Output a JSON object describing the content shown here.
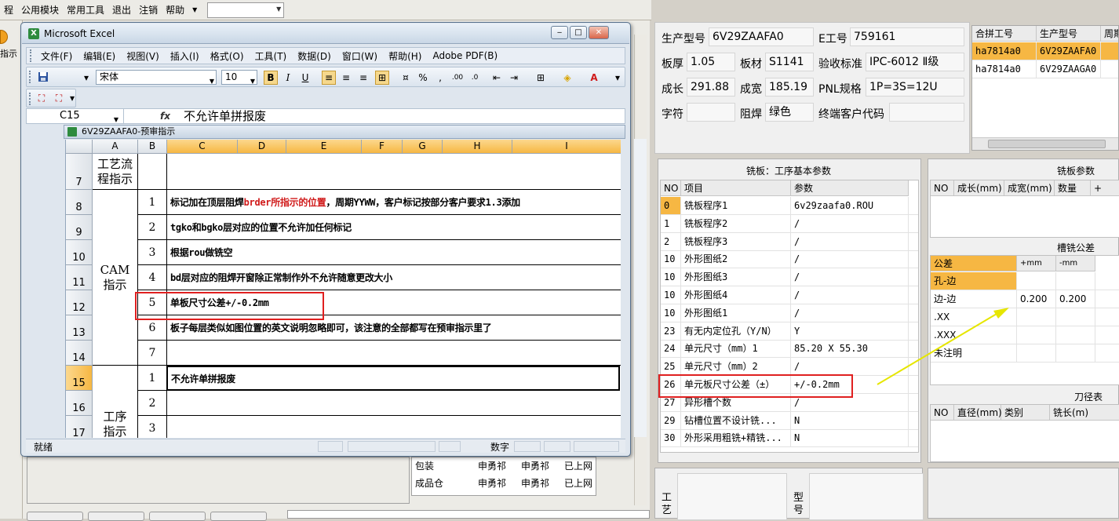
{
  "app_menu": [
    "程",
    "公用模块",
    "常用工具",
    "退出",
    "注销",
    "帮助"
  ],
  "left_label": "指示",
  "excel": {
    "title": "Microsoft Excel",
    "menu": [
      "文件(F)",
      "编辑(E)",
      "视图(V)",
      "插入(I)",
      "格式(O)",
      "工具(T)",
      "数据(D)",
      "窗口(W)",
      "帮助(H)",
      "Adobe PDF(B)"
    ],
    "font_name": "宋体",
    "font_size": "10",
    "name_box": "C15",
    "fx": "fx",
    "formula_value": "不允许单拼报废",
    "workbook_title": "6V29ZAAFA0-预审指示",
    "columns": [
      "A",
      "B",
      "C",
      "D",
      "E",
      "F",
      "G",
      "H",
      "I"
    ],
    "rows": [
      {
        "num": "7",
        "b": "",
        "c": ""
      },
      {
        "num": "8",
        "b": "1",
        "c_pre": "标记加在顶层阻焊",
        "c_red": "brder所指示的位置",
        "c_post": "，周期YYWW，客户标记按部分客户要求1.3添加"
      },
      {
        "num": "9",
        "b": "2",
        "c": "tgko和bgko层对应的位置不允许加任何标记"
      },
      {
        "num": "10",
        "b": "3",
        "c": "根据rou做铣空"
      },
      {
        "num": "11",
        "b": "4",
        "c": "bd层对应的阻焊开窗除正常制作外不允许随意更改大小"
      },
      {
        "num": "12",
        "b": "5",
        "c": "单板尺寸公差+/-0.2mm"
      },
      {
        "num": "13",
        "b": "6",
        "c": "板子每层类似如图位置的英文说明忽略即可，该注意的全部都写在预审指示里了"
      },
      {
        "num": "14",
        "b": "7",
        "c": ""
      },
      {
        "num": "15",
        "b": "1",
        "c": "不允许单拼报废"
      },
      {
        "num": "16",
        "b": "2",
        "c": ""
      },
      {
        "num": "17",
        "b": "3",
        "c": ""
      }
    ],
    "group_labels": {
      "g1": "工艺流程指示",
      "g2": "CAM指示",
      "g3": "工序指示"
    },
    "status_ready": "就绪",
    "status_num": "数字"
  },
  "behind_table": [
    [
      "包装",
      "申勇祁",
      "申勇祁",
      "已上网"
    ],
    [
      "成品仓",
      "申勇祁",
      "申勇祁",
      "已上网"
    ]
  ],
  "product_info": {
    "model_label": "生产型号",
    "model_value": "6V29ZAAFA0",
    "eid_label": "E工号",
    "eid_value": "759161",
    "thick_label": "板厚",
    "thick_value": "1.05",
    "material_label": "板材",
    "material_value": "S1141",
    "accept_label": "验收标准",
    "accept_value": "IPC-6012 Ⅱ级",
    "len_label": "成长",
    "len_value": "291.88",
    "width_label": "成宽",
    "width_value": "185.19",
    "pnl_label": "PNL规格",
    "pnl_value": "1P=3S=12U",
    "char_label": "字符",
    "char_value": "",
    "mask_label": "阻焊",
    "mask_value": "绿色",
    "endcust_label": "终端客户代码",
    "endcust_value": ""
  },
  "merge_table": {
    "headers": [
      "合拼工号",
      "生产型号",
      "周期"
    ],
    "rows": [
      [
        "ha7814a0",
        "6V29ZAAFA0",
        ""
      ],
      [
        "ha7814a0",
        "6V29ZAAGA0",
        ""
      ]
    ]
  },
  "mill_params": {
    "title": "铣板：工序基本参数",
    "headers": [
      "NO",
      "项目",
      "参数"
    ],
    "rows": [
      [
        "0",
        "铣板程序1",
        "6v29zaafa0.ROU"
      ],
      [
        "1",
        "铣板程序2",
        "/"
      ],
      [
        "2",
        "铣板程序3",
        "/"
      ],
      [
        "10",
        "外形图纸2",
        "/"
      ],
      [
        "10",
        "外形图纸3",
        "/"
      ],
      [
        "10",
        "外形图纸4",
        "/"
      ],
      [
        "10",
        "外形图纸1",
        "/"
      ],
      [
        "23",
        "有无内定位孔（Y/N）",
        "Y"
      ],
      [
        "24",
        "单元尺寸（mm）1",
        "85.20 X 55.30"
      ],
      [
        "25",
        "单元尺寸（mm）2",
        "/"
      ],
      [
        "26",
        "单元板尺寸公差（±）",
        "+/-0.2mm"
      ],
      [
        "27",
        "异形槽个数",
        "/"
      ],
      [
        "29",
        "钻槽位置不设计铣...",
        "N"
      ],
      [
        "30",
        "外形采用粗铣+精铣...",
        "N"
      ]
    ]
  },
  "mill_board_params": {
    "title": "铣板参数",
    "headers": [
      "NO",
      "成长(mm)",
      "成宽(mm)",
      "数量",
      "+"
    ]
  },
  "slot_tolerance": {
    "title": "槽铣公差",
    "headers": [
      "公差",
      "+mm",
      "-mm"
    ],
    "rows": [
      [
        "孔-边",
        "",
        ""
      ],
      [
        "边-边",
        "0.200",
        "0.200"
      ],
      [
        ".XX",
        "",
        ""
      ],
      [
        ".XXX",
        "",
        ""
      ],
      [
        "未注明",
        "",
        ""
      ]
    ]
  },
  "tool_table": {
    "title": "刀径表",
    "headers": [
      "NO",
      "直径(mm)",
      "类别",
      "铣长(m)"
    ]
  },
  "bottom_labels": {
    "left": "工艺",
    "right": "型号"
  },
  "colors": {
    "highlight_red": "#e02020",
    "arrow_yellow": "#e6e600",
    "selected_orange": "#f6b743",
    "text_red": "#d01a1a"
  }
}
